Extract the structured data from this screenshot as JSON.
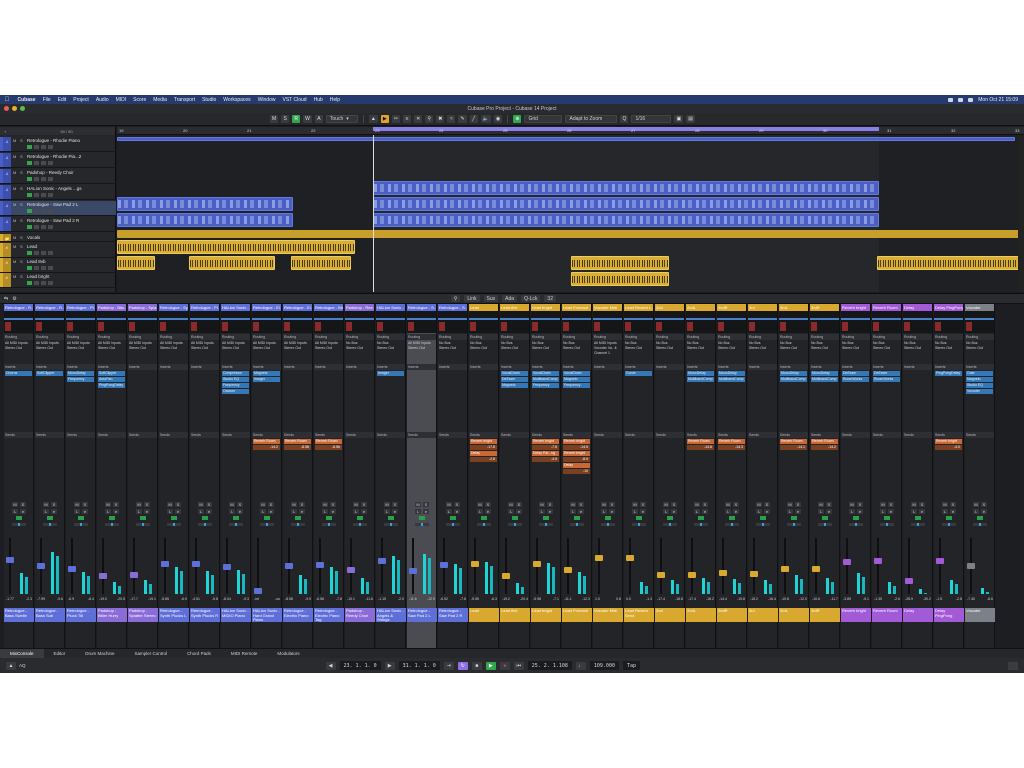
{
  "menubar": {
    "items": [
      "Cubase",
      "File",
      "Edit",
      "Project",
      "Audio",
      "MIDI",
      "Score",
      "Media",
      "Transport",
      "Studio",
      "Workspaces",
      "Window",
      "VST Cloud",
      "Hub",
      "Help"
    ],
    "clock": "Mon Oct 21  15:09"
  },
  "window": {
    "title": "Cubase Pro Project - Cubase 14 Project"
  },
  "toolbar": {
    "mode_R": "R",
    "mode_W": "W",
    "mode_A": "A",
    "automation": "Touch",
    "snap_type": "Grid",
    "zoom_mode": "Adapt to Zoom",
    "quantize": "1/16"
  },
  "ruler": {
    "bars": [
      "19",
      "20",
      "21",
      "22",
      "23",
      "24",
      "25",
      "26",
      "27",
      "28",
      "29",
      "30",
      "31",
      "32",
      "33",
      "34"
    ]
  },
  "tracks": [
    {
      "name": "Retrologue - Rhodie Piano",
      "kind": "midi"
    },
    {
      "name": "Retrologue - Rhodie Pia...2",
      "kind": "midi"
    },
    {
      "name": "Padshop - Reedy Choir",
      "kind": "midi"
    },
    {
      "name": "HALion Sonic - Angels ...gs",
      "kind": "midi"
    },
    {
      "name": "Retrologue - Saw Pad 2 L",
      "kind": "midi"
    },
    {
      "name": "Retrologue - Saw Pad 2 R",
      "kind": "midi"
    },
    {
      "name": "Vocals",
      "kind": "folder"
    },
    {
      "name": "Lead",
      "kind": "audio"
    },
    {
      "name": "Lead 8vb",
      "kind": "audio"
    },
    {
      "name": "Lead bright",
      "kind": "audio"
    }
  ],
  "tracklist_header": "90 / 90",
  "mixer": {
    "toolbar": {
      "link": "Link",
      "sus": "Sus",
      "ada": "Ada",
      "lock": "Q-Lck",
      "count": "32"
    },
    "labels": {
      "routing": "Routing",
      "inserts": "Inserts",
      "sends": "Sends"
    },
    "channels": [
      {
        "top": "Retrologue - R...",
        "in": "All MIDI Inputs",
        "out": "Stereo Out",
        "inserts": [
          "Chorus"
        ],
        "sends": [],
        "vol": "-1.77",
        "pk": "-2.3",
        "bottom": "Retrologue - Bass Swelle",
        "color": "#5f6fd8",
        "fader": 0.62,
        "meter": 0.38
      },
      {
        "top": "Retrologue - R...",
        "in": "All MIDI Inputs",
        "out": "Stereo Out",
        "inserts": [
          "SoftClipper"
        ],
        "sends": [],
        "vol": "-7.99",
        "pk": "-9.6",
        "bottom": "Retrologue - Bass Sub",
        "color": "#5f6fd8",
        "fader": 0.5,
        "meter": 0.78
      },
      {
        "top": "Retrologue - Pl...",
        "in": "All MIDI Inputs",
        "out": "Stereo Out",
        "inserts": [
          "MonoDelay",
          "Frequency"
        ],
        "sends": [],
        "vol": "-6.9",
        "pk": "-8.4",
        "bottom": "Retrologue - Pluck Tilt",
        "color": "#5f6fd8",
        "fader": 0.45,
        "meter": 0.4
      },
      {
        "top": "Padshop - Bitc...",
        "in": "All MIDI Inputs",
        "out": "Stereo Out",
        "inserts": [
          "SoftClipper",
          "AutoPan",
          "PingPongDelay"
        ],
        "sends": [],
        "vol": "-19.0",
        "pk": "-20.5",
        "bottom": "Padshop - Bitter Hurry",
        "color": "#8a6cd8",
        "fader": 0.3,
        "meter": 0.22
      },
      {
        "top": "Padshop - Spla...",
        "in": "All MIDI Inputs",
        "out": "Stereo Out",
        "inserts": [],
        "sends": [],
        "vol": "-17.7",
        "pk": "-19.1",
        "bottom": "Padshop - Splatter Stereo",
        "color": "#8a6cd8",
        "fader": 0.32,
        "meter": 0.25
      },
      {
        "top": "Retrologue - Sy...",
        "in": "All MIDI Inputs",
        "out": "Stereo Out",
        "inserts": [],
        "sends": [],
        "vol": "-5.65",
        "pk": "-6.9",
        "bottom": "Retrologue - Synth Plucks L",
        "color": "#5f6fd8",
        "fader": 0.55,
        "meter": 0.5
      },
      {
        "top": "Retrologue - Pl...",
        "in": "All MIDI Inputs",
        "out": "Stereo Out",
        "inserts": [],
        "sends": [],
        "vol": "-4.51",
        "pk": "-5.8",
        "bottom": "Retrologue - Synth Plucks R",
        "color": "#5f6fd8",
        "fader": 0.55,
        "meter": 0.42
      },
      {
        "top": "HALion Sonic - ...",
        "in": "All MIDI Inputs",
        "out": "Stereo Out",
        "inserts": [
          "Compressor",
          "Studio EQ",
          "Frequency",
          "Octaver"
        ],
        "sends": [],
        "vol": "-8.04",
        "pk": "-9.3",
        "bottom": "HALion Sonic - MIDIO Piano",
        "color": "#5f6fd8",
        "fader": 0.48,
        "meter": 0.45
      },
      {
        "top": "Retrologue - El...",
        "in": "All MIDI Inputs",
        "out": "Stereo Out",
        "inserts": [
          "Magneto",
          "Imager"
        ],
        "sends": [
          {
            "name": "Reverb Room",
            "val": "-14.2"
          }
        ],
        "vol": "-inf",
        "pk": "-oo",
        "bottom": "HALion Sonic - Hard Grand Piano",
        "color": "#5f6fd8",
        "fader": 0.0,
        "meter": 0.0
      },
      {
        "top": "Retrologue - El...",
        "in": "All MIDI Inputs",
        "out": "Stereo Out",
        "inserts": [],
        "sends": [
          {
            "name": "Reverb Room",
            "val": "-8.58"
          }
        ],
        "vol": "-8.58",
        "pk": "-9.9",
        "bottom": "Retrologue - Electric Piano",
        "color": "#5f6fd8",
        "fader": 0.5,
        "meter": 0.35
      },
      {
        "top": "Retrologue - Bla...",
        "in": "All MIDI Inputs",
        "out": "Stereo Out",
        "inserts": [],
        "sends": [
          {
            "name": "Reverb Room",
            "val": "-6.56"
          }
        ],
        "vol": "-6.56",
        "pk": "-7.8",
        "bottom": "Retrologue - Electric Piano Tag",
        "color": "#5f6fd8",
        "fader": 0.52,
        "meter": 0.5
      },
      {
        "top": "Padshop - Ree...",
        "in": "No Bus",
        "out": "Stereo Out",
        "inserts": [],
        "sends": [],
        "vol": "-10.1",
        "pk": "-11.6",
        "bottom": "Padshop - Reedy Choir",
        "color": "#8a6cd8",
        "fader": 0.42,
        "meter": 0.3
      },
      {
        "top": "HALion Sonic - ...",
        "in": "No Bus",
        "out": "Stereo Out",
        "inserts": [
          "Imager"
        ],
        "sends": [],
        "vol": "-1.15",
        "pk": "-2.0",
        "bottom": "HALion Sonic - Angels & Strings",
        "color": "#5f6fd8",
        "fader": 0.6,
        "meter": 0.7
      },
      {
        "top": "Retrologue - S...",
        "in": "All MIDI Inputs",
        "out": "Stereo Out",
        "inserts": [],
        "sends": [],
        "vol": "-11.6",
        "pk": "-12.9",
        "bottom": "Retrologue - Saw Pad 2 L",
        "color": "#5f6fd8",
        "fader": 0.4,
        "meter": 0.74,
        "selected": true
      },
      {
        "top": "Retrologue - S...",
        "in": "No Bus",
        "out": "Stereo Out",
        "inserts": [],
        "sends": [],
        "vol": "-6.52",
        "pk": "-7.6",
        "bottom": "Retrologue - Saw Pad 2 R",
        "color": "#5f6fd8",
        "fader": 0.52,
        "meter": 0.55
      },
      {
        "top": "Lead",
        "in": "No Bus",
        "out": "Stereo Out",
        "inserts": [],
        "sends": [
          {
            "name": "Reverb bright",
            "val": "-17.8"
          },
          {
            "name": "Delay",
            "val": "-2.8"
          }
        ],
        "vol": "-5.55",
        "pk": "-6.3",
        "bottom": "Lead",
        "color": "#d9a82e",
        "fader": 0.54,
        "meter": 0.6
      },
      {
        "top": "Lead 8vb",
        "in": "No Bus",
        "out": "Stereo Out",
        "inserts": [
          "VocalChain",
          "DeEsser",
          "Magneto"
        ],
        "sends": [],
        "vol": "-19.2",
        "pk": "-20.4",
        "bottom": "Lead 8vb",
        "color": "#d9a82e",
        "fader": 0.3,
        "meter": 0.2
      },
      {
        "top": "Lead bright",
        "in": "No Bus",
        "out": "Stereo Out",
        "inserts": [
          "VocalChain",
          "MultibandComp",
          "Frequency"
        ],
        "sends": [
          {
            "name": "Reverb bright",
            "val": "-7.5"
          },
          {
            "name": "Delay Pat...ng",
            "val": "-4.9"
          }
        ],
        "vol": "-5.98",
        "pk": "-7.1",
        "bottom": "Lead bright",
        "color": "#d9a82e",
        "fader": 0.55,
        "meter": 0.58
      },
      {
        "top": "Lead Formant",
        "in": "No Bus",
        "out": "Stereo Out",
        "inserts": [
          "VocalChain",
          "Magneto",
          "Frequency"
        ],
        "sends": [
          {
            "name": "Reverb bright",
            "val": "-14.5"
          },
          {
            "name": "Reverb bright",
            "val": "-8.9"
          },
          {
            "name": "Delay",
            "val": "-10"
          }
        ],
        "vol": "-11.1",
        "pk": "-12.3",
        "bottom": "Lead Formant",
        "color": "#d9a82e",
        "fader": 0.42,
        "meter": 0.4
      },
      {
        "top": "Vocoder Midi",
        "in": "All MIDI Inputs",
        "out": "Vocoder Va...lt",
        "inserts": [],
        "sends": [],
        "vol": "1.0",
        "pk": "0.8",
        "bottom": "Vocoder Midi",
        "color": "#d9a82e",
        "fader": 0.66,
        "meter": 0.0,
        "extra": "Channel 1"
      },
      {
        "top": "Lead Reverb L...",
        "in": "No Bus",
        "out": "Stereo Out",
        "inserts": [
          "Gurve"
        ],
        "sends": [],
        "vol": "0.0",
        "pk": "-1.3",
        "bottom": "Lead Reverb Send",
        "color": "#d9a82e",
        "fader": 0.66,
        "meter": 0.22
      },
      {
        "top": "2nd",
        "in": "No Bus",
        "out": "Stereo Out",
        "inserts": [],
        "sends": [],
        "vol": "-17.4",
        "pk": "-18.8",
        "bottom": "2nd",
        "color": "#d9a82e",
        "fader": 0.32,
        "meter": 0.25
      },
      {
        "top": "2ndL",
        "in": "No Bus",
        "out": "Stereo Out",
        "inserts": [
          "MonoDelay",
          "MultibandComp"
        ],
        "sends": [
          {
            "name": "Reverb Room",
            "val": "-14.6"
          }
        ],
        "vol": "-17.4",
        "pk": "-18.2",
        "bottom": "2ndL",
        "color": "#d9a82e",
        "fader": 0.32,
        "meter": 0.3
      },
      {
        "top": "2ndR",
        "in": "No Bus",
        "out": "Stereo Out",
        "inserts": [
          "MonoDelay",
          "MultibandComp"
        ],
        "sends": [
          {
            "name": "Reverb Room",
            "val": "-14.3"
          }
        ],
        "vol": "-14.4",
        "pk": "-15.8",
        "bottom": "2ndR",
        "color": "#d9a82e",
        "fader": 0.36,
        "meter": 0.28
      },
      {
        "top": "3rd",
        "in": "No Bus",
        "out": "Stereo Out",
        "inserts": [],
        "sends": [],
        "vol": "-15.2",
        "pk": "-16.4",
        "bottom": "3rd",
        "color": "#d9a82e",
        "fader": 0.34,
        "meter": 0.25
      },
      {
        "top": "3rdL",
        "in": "No Bus",
        "out": "Stereo Out",
        "inserts": [
          "MonoDelay",
          "MultibandComp"
        ],
        "sends": [
          {
            "name": "Reverb Room",
            "val": "-14.1"
          }
        ],
        "vol": "-10.8",
        "pk": "-12.0",
        "bottom": "3rdL",
        "color": "#d9a82e",
        "fader": 0.44,
        "meter": 0.35
      },
      {
        "top": "3rdR",
        "in": "No Bus",
        "out": "Stereo Out",
        "inserts": [
          "MonoDelay",
          "MultibandComp"
        ],
        "sends": [
          {
            "name": "Reverb Room",
            "val": "-14.2"
          }
        ],
        "vol": "-10.6",
        "pk": "-11.7",
        "bottom": "3rdR",
        "color": "#d9a82e",
        "fader": 0.44,
        "meter": 0.3
      },
      {
        "top": "Reverb bright",
        "in": "No Bus",
        "out": "Stereo Out",
        "inserts": [
          "DeEsser",
          "RoomWorks"
        ],
        "sends": [],
        "vol": "-3.85",
        "pk": "-5.1",
        "bottom": "Reverb bright",
        "color": "#a25ad6",
        "fader": 0.58,
        "meter": 0.38
      },
      {
        "top": "Reverb Room",
        "in": "No Bus",
        "out": "Stereo Out",
        "inserts": [
          "DeEsser",
          "RoomWorks"
        ],
        "sends": [],
        "vol": "-1.35",
        "pk": "-2.6",
        "bottom": "Reverb Room",
        "color": "#a25ad6",
        "fader": 0.6,
        "meter": 0.22
      },
      {
        "top": "Delay",
        "in": "No Bus",
        "out": "Stereo Out",
        "inserts": [],
        "sends": [],
        "vol": "-28.9",
        "pk": "-30.2",
        "bottom": "Delay",
        "color": "#a25ad6",
        "fader": 0.2,
        "meter": 0.1
      },
      {
        "top": "Delay PingPong",
        "in": "No Bus",
        "out": "Stereo Out",
        "inserts": [
          "PingPongDelay"
        ],
        "sends": [
          {
            "name": "Reverb bright",
            "val": "-4.0"
          }
        ],
        "vol": "-1.5",
        "pk": "-2.8",
        "bottom": "Delay PingPong",
        "color": "#a25ad6",
        "fader": 0.6,
        "meter": 0.25
      },
      {
        "top": "Vocoder",
        "in": "No Bus",
        "out": "Stereo Out",
        "inserts": [
          "Gate",
          "Magneto",
          "Studio EQ",
          "Vocoder"
        ],
        "sends": [],
        "vol": "-7.40",
        "pk": "-8.6",
        "bottom": "Vocoder",
        "color": "#7b8089",
        "fader": 0.5,
        "meter": 0.12
      }
    ]
  },
  "bottomtabs": [
    "MixConsole",
    "Editor",
    "Drum Machine",
    "Sampler Control",
    "Chord Pads",
    "MIDI Remote",
    "Modulators"
  ],
  "transport": {
    "left_locator": "23. 1. 1. 0",
    "right_locator": "31. 1. 1. 0",
    "position": "25. 2. 1.108",
    "tempo": "109.000",
    "signature": "Tap"
  }
}
